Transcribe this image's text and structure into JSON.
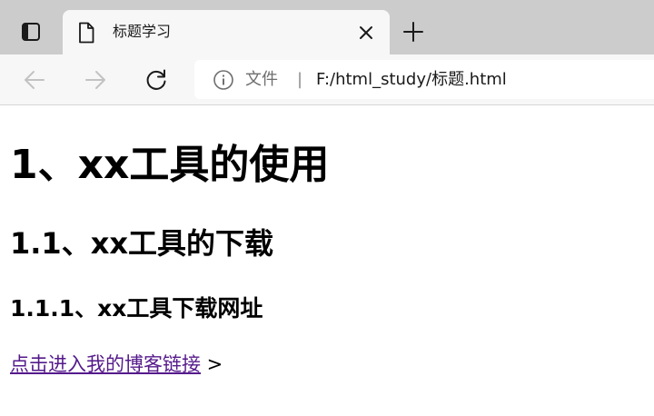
{
  "tab": {
    "title": "标题学习"
  },
  "toolbar": {
    "origin_label": "文件",
    "separator": "|",
    "url": "F:/html_study/标题.html"
  },
  "page": {
    "h1": "1、xx工具的使用",
    "h2": "1.1、xx工具的下载",
    "h3": "1.1.1、xx工具下载网址",
    "link_text": "点击进入我的博客链接",
    "link_suffix": " >"
  },
  "icons": {
    "tab_actions": "tab-actions-icon",
    "favicon": "document-icon",
    "close": "close-icon",
    "new_tab": "plus-icon",
    "back": "arrow-left-icon",
    "forward": "arrow-right-icon",
    "reload": "reload-icon",
    "info": "info-icon"
  }
}
